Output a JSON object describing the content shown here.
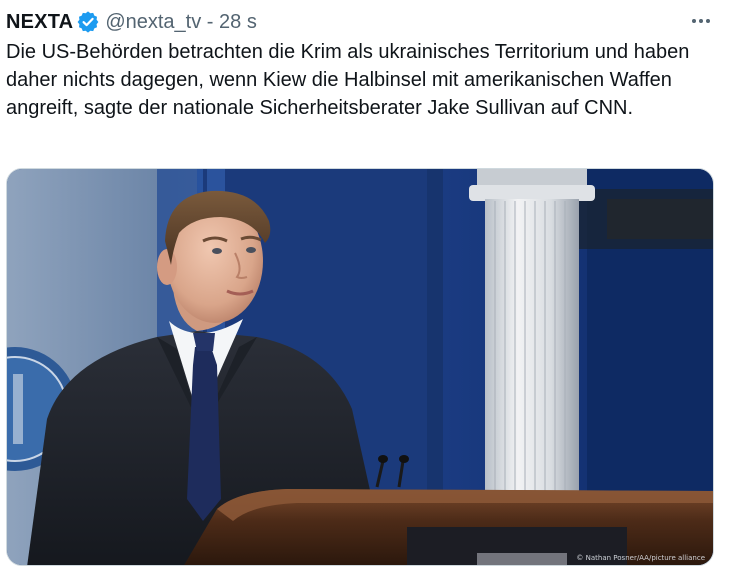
{
  "tweet": {
    "author": {
      "display_name": "NEXTA",
      "verified": true,
      "verified_icon": "verified-badge-icon",
      "handle": "@nexta_tv",
      "separator": "-",
      "timestamp": "28 s"
    },
    "more_icon": "more-horizontal-icon",
    "text": "Die US-Behörden betrachten die Krim als ukrainisches Territorium und haben daher nichts dagegen, wenn Kiew die Halbinsel mit amerikanischen Waffen angreift, sagte der nationale Sicherheitsberater Jake Sullivan auf CNN.",
    "media": {
      "credit": "© Nathan Posner/AA/picture alliance"
    }
  },
  "colors": {
    "text": "#0f1419",
    "secondary": "#536471",
    "verified_blue": "#1d9bf0",
    "border": "#cfd9de"
  }
}
